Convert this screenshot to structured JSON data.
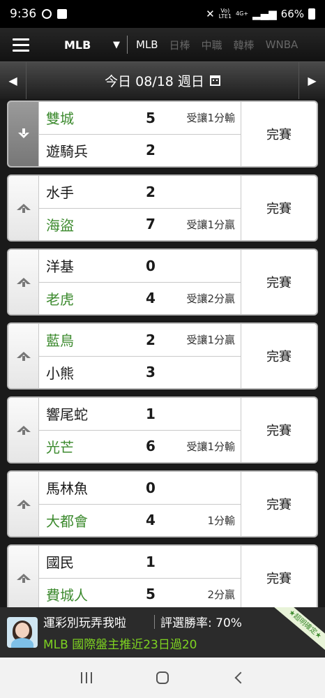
{
  "status_bar": {
    "time": "9:36",
    "network": "4G+",
    "battery": "66%"
  },
  "nav": {
    "league_selected": "MLB",
    "tabs": [
      {
        "label": "MLB",
        "active": true
      },
      {
        "label": "日棒",
        "active": false
      },
      {
        "label": "中職",
        "active": false
      },
      {
        "label": "韓棒",
        "active": false
      },
      {
        "label": "WNBA",
        "active": false
      }
    ]
  },
  "date_bar": {
    "label": "今日 08/18 週日",
    "prev_icon": "left-arrow-icon",
    "next_icon": "right-arrow-icon"
  },
  "games": [
    {
      "expanded": true,
      "away": {
        "name": "雙城",
        "score": "5",
        "note": "受讓1分輸",
        "favored": true
      },
      "home": {
        "name": "遊騎兵",
        "score": "2",
        "note": "",
        "favored": false
      },
      "status": "完賽"
    },
    {
      "expanded": false,
      "away": {
        "name": "水手",
        "score": "2",
        "note": "",
        "favored": false
      },
      "home": {
        "name": "海盜",
        "score": "7",
        "note": "受讓1分贏",
        "favored": true
      },
      "status": "完賽"
    },
    {
      "expanded": false,
      "away": {
        "name": "洋基",
        "score": "0",
        "note": "",
        "favored": false
      },
      "home": {
        "name": "老虎",
        "score": "4",
        "note": "受讓2分贏",
        "favored": true
      },
      "status": "完賽"
    },
    {
      "expanded": false,
      "away": {
        "name": "藍鳥",
        "score": "2",
        "note": "受讓1分贏",
        "favored": true
      },
      "home": {
        "name": "小熊",
        "score": "3",
        "note": "",
        "favored": false
      },
      "status": "完賽"
    },
    {
      "expanded": false,
      "away": {
        "name": "響尾蛇",
        "score": "1",
        "note": "",
        "favored": false
      },
      "home": {
        "name": "光芒",
        "score": "6",
        "note": "受讓1分輸",
        "favored": true
      },
      "status": "完賽"
    },
    {
      "expanded": false,
      "away": {
        "name": "馬林魚",
        "score": "0",
        "note": "",
        "favored": false
      },
      "home": {
        "name": "大都會",
        "score": "4",
        "note": "1分輸",
        "favored": true
      },
      "status": "完賽"
    },
    {
      "expanded": false,
      "away": {
        "name": "國民",
        "score": "1",
        "note": "",
        "favored": false
      },
      "home": {
        "name": "費城人",
        "score": "5",
        "note": "2分贏",
        "favored": true
      },
      "status": "完賽"
    }
  ],
  "ad": {
    "title": "運彩別玩弄我啦",
    "rating": "評選勝率: 70%",
    "subtitle": "MLB 國際盤主推近23日過20",
    "ribbon": "★超明確定★"
  }
}
